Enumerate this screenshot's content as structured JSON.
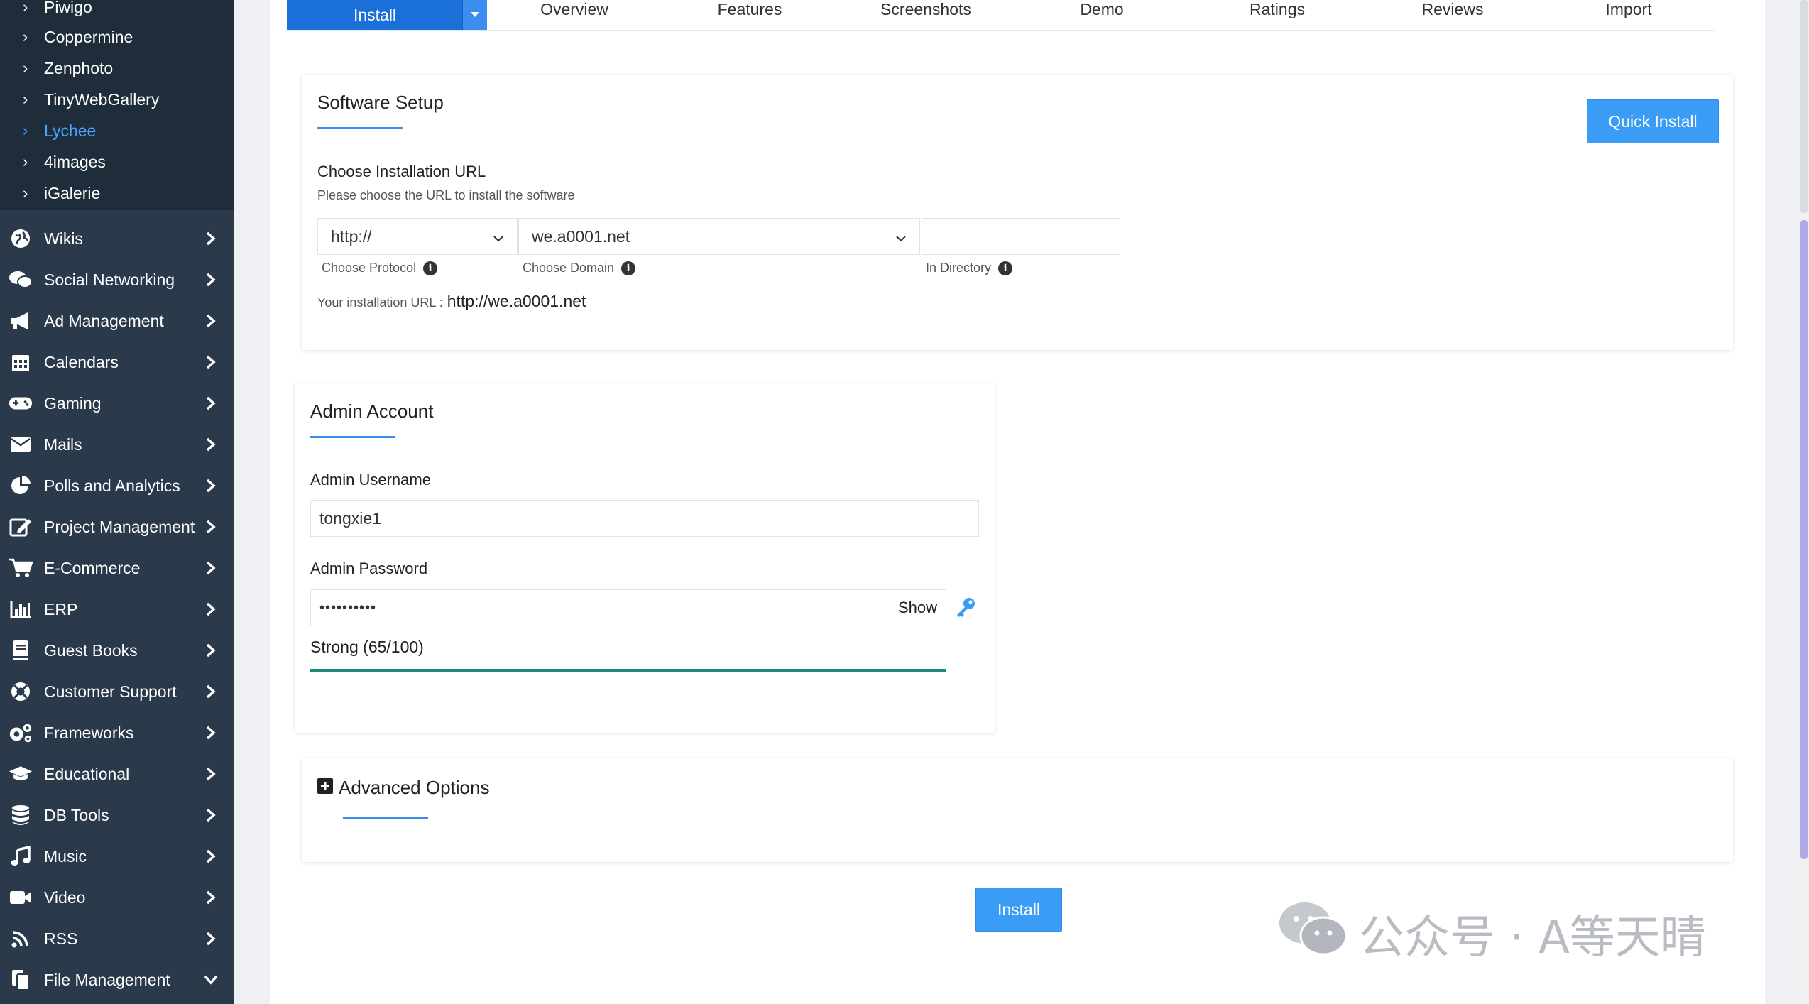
{
  "sidebar": {
    "sub_items": [
      {
        "label": "Piwigo",
        "active": false
      },
      {
        "label": "Coppermine",
        "active": false
      },
      {
        "label": "Zenphoto",
        "active": false
      },
      {
        "label": "TinyWebGallery",
        "active": false
      },
      {
        "label": "Lychee",
        "active": true
      },
      {
        "label": "4images",
        "active": false
      },
      {
        "label": "iGalerie",
        "active": false
      }
    ],
    "categories": [
      {
        "label": "Wikis",
        "icon": "globe-icon"
      },
      {
        "label": "Social Networking",
        "icon": "chat-icon"
      },
      {
        "label": "Ad Management",
        "icon": "megaphone-icon"
      },
      {
        "label": "Calendars",
        "icon": "calendar-icon"
      },
      {
        "label": "Gaming",
        "icon": "gamepad-icon"
      },
      {
        "label": "Mails",
        "icon": "envelope-icon"
      },
      {
        "label": "Polls and Analytics",
        "icon": "pie-chart-icon"
      },
      {
        "label": "Project Management",
        "icon": "edit-icon"
      },
      {
        "label": "E-Commerce",
        "icon": "cart-icon"
      },
      {
        "label": "ERP",
        "icon": "bar-chart-icon"
      },
      {
        "label": "Guest Books",
        "icon": "book-icon"
      },
      {
        "label": "Customer Support",
        "icon": "lifebuoy-icon"
      },
      {
        "label": "Frameworks",
        "icon": "gears-icon"
      },
      {
        "label": "Educational",
        "icon": "graduation-cap-icon"
      },
      {
        "label": "DB Tools",
        "icon": "database-icon"
      },
      {
        "label": "Music",
        "icon": "music-icon"
      },
      {
        "label": "Video",
        "icon": "video-icon"
      },
      {
        "label": "RSS",
        "icon": "rss-icon"
      },
      {
        "label": "File Management",
        "icon": "files-icon"
      }
    ]
  },
  "tabs": {
    "install": "Install",
    "items": [
      "Overview",
      "Features",
      "Screenshots",
      "Demo",
      "Ratings",
      "Reviews",
      "Import"
    ]
  },
  "software_setup": {
    "title": "Software Setup",
    "quick_install": "Quick Install",
    "choose_url_label": "Choose Installation URL",
    "choose_url_hint": "Please choose the URL to install the software",
    "protocol_value": "http://",
    "domain_value": "we.a0001.net",
    "directory_value": "",
    "protocol_label": "Choose Protocol",
    "domain_label": "Choose Domain",
    "directory_label": "In Directory",
    "install_url_label": "Your installation URL :",
    "install_url_value": "http://we.a0001.net"
  },
  "admin_account": {
    "title": "Admin Account",
    "username_label": "Admin Username",
    "username_value": "tongxie1",
    "password_label": "Admin Password",
    "password_value": "••••••••••",
    "show_label": "Show",
    "strength_text": "Strong (65/100)",
    "strength_color": "#1b8c7a"
  },
  "advanced": {
    "title": "Advanced Options"
  },
  "install_button": "Install",
  "watermark": {
    "text": "公众号 · A等天晴"
  },
  "colors": {
    "accent": "#3b9cf5",
    "sidebar_bg": "#2b3a4b",
    "active_link": "#4aa3ff"
  }
}
